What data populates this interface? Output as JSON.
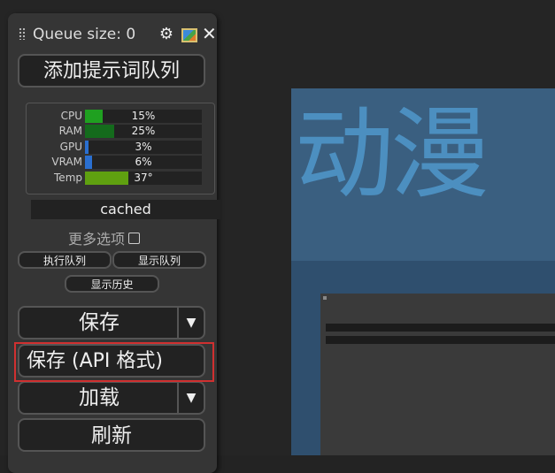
{
  "menu": {
    "queue_label": "Queue size: 0",
    "queue_button": "添加提示词队列",
    "stats": [
      {
        "label": "CPU",
        "value": "15%",
        "percent": 15,
        "color": "#1fa020"
      },
      {
        "label": "RAM",
        "value": "25%",
        "percent": 25,
        "color": "#146b1c"
      },
      {
        "label": "GPU",
        "value": "3%",
        "percent": 3,
        "color": "#2a6fd0"
      },
      {
        "label": "VRAM",
        "value": "6%",
        "percent": 6,
        "color": "#2a6fd0"
      },
      {
        "label": "Temp",
        "value": "37°",
        "percent": 37,
        "color": "#5fa010"
      }
    ],
    "cached": "cached",
    "more_options": "更多选项",
    "run_queue": "执行队列",
    "show_queue": "显示队列",
    "show_history": "显示历史",
    "save": "保存",
    "save_api": "保存 (API 格式)",
    "load": "加载",
    "refresh": "刷新",
    "dropdown_arrow": "▼",
    "close": "✕"
  },
  "preview": {
    "text": "动漫"
  },
  "colors": {
    "highlight": "#d03030",
    "preview_banner": "#3a5f80",
    "preview_text": "#4c8fc0"
  }
}
